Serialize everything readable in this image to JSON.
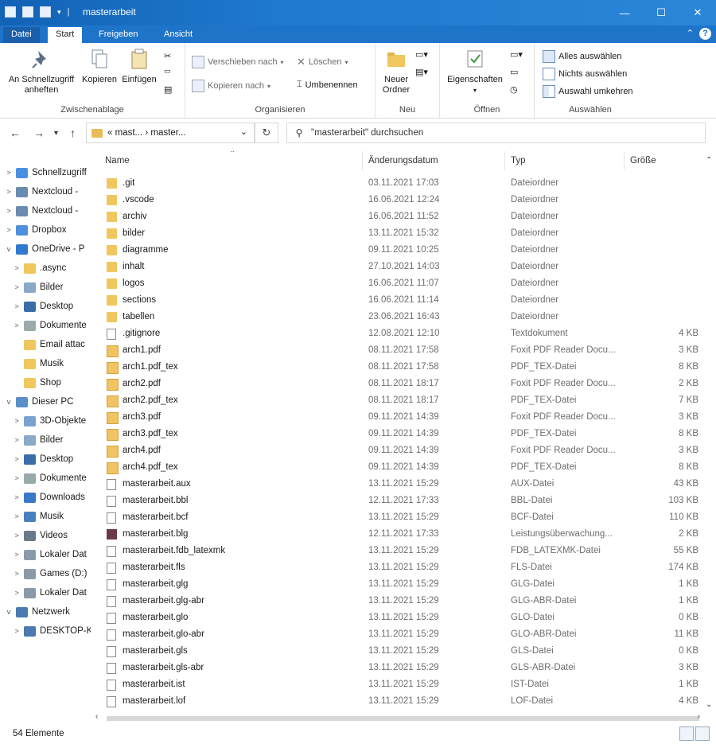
{
  "window": {
    "title": "masterarbeit",
    "controls": {
      "minimize": "—",
      "maximize": "☐",
      "close": "✕"
    }
  },
  "ribbon_tabs": [
    "Datei",
    "Start",
    "Freigeben",
    "Ansicht"
  ],
  "ribbon": {
    "zwischenablage": {
      "label": "Zwischenablage",
      "pin": "An Schnellzugriff anheften",
      "copy": "Kopieren",
      "paste": "Einfügen"
    },
    "organisieren": {
      "label": "Organisieren",
      "move": "Verschieben nach",
      "copy_to": "Kopieren nach",
      "delete": "Löschen",
      "rename": "Umbenennen"
    },
    "neu": {
      "label": "Neu",
      "new_folder": "Neuer Ordner"
    },
    "oeffnen": {
      "label": "Öffnen",
      "properties": "Eigenschaften"
    },
    "auswaehlen": {
      "label": "Auswählen",
      "select_all": "Alles auswählen",
      "select_none": "Nichts auswählen",
      "invert": "Auswahl umkehren"
    }
  },
  "address": {
    "crumbs": [
      "«",
      "mast...",
      "›",
      "master..."
    ],
    "search_placeholder": "\"masterarbeit\" durchsuchen"
  },
  "nav": [
    {
      "label": "Schnellzugriff",
      "indent": 0,
      "arrow": ">",
      "icon": "star-icon"
    },
    {
      "label": "Nextcloud -",
      "indent": 0,
      "arrow": ">",
      "icon": "cloud-icon"
    },
    {
      "label": "Nextcloud -",
      "indent": 0,
      "arrow": ">",
      "icon": "cloud-icon"
    },
    {
      "label": "Dropbox",
      "indent": 0,
      "arrow": ">",
      "icon": "dropbox-icon"
    },
    {
      "label": "OneDrive - P",
      "indent": 0,
      "arrow": "v",
      "icon": "onedrive-icon"
    },
    {
      "label": ".async",
      "indent": 1,
      "arrow": ">",
      "icon": "folder-icon"
    },
    {
      "label": "Bilder",
      "indent": 1,
      "arrow": ">",
      "icon": "pictures-icon"
    },
    {
      "label": "Desktop",
      "indent": 1,
      "arrow": ">",
      "icon": "desktop-icon"
    },
    {
      "label": "Dokumente",
      "indent": 1,
      "arrow": ">",
      "icon": "documents-icon"
    },
    {
      "label": "Email attac",
      "indent": 1,
      "arrow": "",
      "icon": "folder-icon"
    },
    {
      "label": "Musik",
      "indent": 1,
      "arrow": "",
      "icon": "folder-icon"
    },
    {
      "label": "Shop",
      "indent": 1,
      "arrow": "",
      "icon": "folder-icon"
    },
    {
      "label": "Dieser PC",
      "indent": 0,
      "arrow": "v",
      "icon": "pc-icon"
    },
    {
      "label": "3D-Objekte",
      "indent": 1,
      "arrow": ">",
      "icon": "3d-icon"
    },
    {
      "label": "Bilder",
      "indent": 1,
      "arrow": ">",
      "icon": "pictures-icon"
    },
    {
      "label": "Desktop",
      "indent": 1,
      "arrow": ">",
      "icon": "desktop-icon"
    },
    {
      "label": "Dokumente",
      "indent": 1,
      "arrow": ">",
      "icon": "documents-icon"
    },
    {
      "label": "Downloads",
      "indent": 1,
      "arrow": ">",
      "icon": "downloads-icon"
    },
    {
      "label": "Musik",
      "indent": 1,
      "arrow": ">",
      "icon": "music-icon"
    },
    {
      "label": "Videos",
      "indent": 1,
      "arrow": ">",
      "icon": "videos-icon"
    },
    {
      "label": "Lokaler Dat",
      "indent": 1,
      "arrow": ">",
      "icon": "drive-icon"
    },
    {
      "label": "Games (D:)",
      "indent": 1,
      "arrow": ">",
      "icon": "drive-icon"
    },
    {
      "label": "Lokaler Dat",
      "indent": 1,
      "arrow": ">",
      "icon": "drive-icon"
    },
    {
      "label": "Netzwerk",
      "indent": 0,
      "arrow": "v",
      "icon": "network-icon"
    },
    {
      "label": "DESKTOP-K",
      "indent": 1,
      "arrow": ">",
      "icon": "computer-icon"
    }
  ],
  "columns": {
    "name": "Name",
    "date": "Änderungsdatum",
    "type": "Typ",
    "size": "Größe"
  },
  "files": [
    {
      "name": ".git",
      "date": "03.11.2021 17:03",
      "type": "Dateiordner",
      "size": "",
      "kind": "folder"
    },
    {
      "name": ".vscode",
      "date": "16.06.2021 12:24",
      "type": "Dateiordner",
      "size": "",
      "kind": "folder"
    },
    {
      "name": "archiv",
      "date": "16.06.2021 11:52",
      "type": "Dateiordner",
      "size": "",
      "kind": "folder"
    },
    {
      "name": "bilder",
      "date": "13.11.2021 15:32",
      "type": "Dateiordner",
      "size": "",
      "kind": "folder"
    },
    {
      "name": "diagramme",
      "date": "09.11.2021 10:25",
      "type": "Dateiordner",
      "size": "",
      "kind": "folder"
    },
    {
      "name": "inhalt",
      "date": "27.10.2021 14:03",
      "type": "Dateiordner",
      "size": "",
      "kind": "folder"
    },
    {
      "name": "logos",
      "date": "16.06.2021 11:07",
      "type": "Dateiordner",
      "size": "",
      "kind": "folder"
    },
    {
      "name": "sections",
      "date": "16.06.2021 11:14",
      "type": "Dateiordner",
      "size": "",
      "kind": "folder"
    },
    {
      "name": "tabellen",
      "date": "23.06.2021 16:43",
      "type": "Dateiordner",
      "size": "",
      "kind": "folder"
    },
    {
      "name": ".gitignore",
      "date": "12.08.2021 12:10",
      "type": "Textdokument",
      "size": "4 KB",
      "kind": "file"
    },
    {
      "name": "arch1.pdf",
      "date": "08.11.2021 17:58",
      "type": "Foxit PDF Reader Docu...",
      "size": "3 KB",
      "kind": "pdf"
    },
    {
      "name": "arch1.pdf_tex",
      "date": "08.11.2021 17:58",
      "type": "PDF_TEX-Datei",
      "size": "8 KB",
      "kind": "pdf"
    },
    {
      "name": "arch2.pdf",
      "date": "08.11.2021 18:17",
      "type": "Foxit PDF Reader Docu...",
      "size": "2 KB",
      "kind": "pdf"
    },
    {
      "name": "arch2.pdf_tex",
      "date": "08.11.2021 18:17",
      "type": "PDF_TEX-Datei",
      "size": "7 KB",
      "kind": "pdf"
    },
    {
      "name": "arch3.pdf",
      "date": "09.11.2021 14:39",
      "type": "Foxit PDF Reader Docu...",
      "size": "3 KB",
      "kind": "pdf"
    },
    {
      "name": "arch3.pdf_tex",
      "date": "09.11.2021 14:39",
      "type": "PDF_TEX-Datei",
      "size": "8 KB",
      "kind": "pdf"
    },
    {
      "name": "arch4.pdf",
      "date": "09.11.2021 14:39",
      "type": "Foxit PDF Reader Docu...",
      "size": "3 KB",
      "kind": "pdf"
    },
    {
      "name": "arch4.pdf_tex",
      "date": "09.11.2021 14:39",
      "type": "PDF_TEX-Datei",
      "size": "8 KB",
      "kind": "pdf"
    },
    {
      "name": "masterarbeit.aux",
      "date": "13.11.2021 15:29",
      "type": "AUX-Datei",
      "size": "43 KB",
      "kind": "file"
    },
    {
      "name": "masterarbeit.bbl",
      "date": "12.11.2021 17:33",
      "type": "BBL-Datei",
      "size": "103 KB",
      "kind": "file"
    },
    {
      "name": "masterarbeit.bcf",
      "date": "13.11.2021 15:29",
      "type": "BCF-Datei",
      "size": "110 KB",
      "kind": "file"
    },
    {
      "name": "masterarbeit.blg",
      "date": "12.11.2021 17:33",
      "type": "Leistungsüberwachung...",
      "size": "2 KB",
      "kind": "blg"
    },
    {
      "name": "masterarbeit.fdb_latexmk",
      "date": "13.11.2021 15:29",
      "type": "FDB_LATEXMK-Datei",
      "size": "55 KB",
      "kind": "file"
    },
    {
      "name": "masterarbeit.fls",
      "date": "13.11.2021 15:29",
      "type": "FLS-Datei",
      "size": "174 KB",
      "kind": "file"
    },
    {
      "name": "masterarbeit.glg",
      "date": "13.11.2021 15:29",
      "type": "GLG-Datei",
      "size": "1 KB",
      "kind": "file"
    },
    {
      "name": "masterarbeit.glg-abr",
      "date": "13.11.2021 15:29",
      "type": "GLG-ABR-Datei",
      "size": "1 KB",
      "kind": "file"
    },
    {
      "name": "masterarbeit.glo",
      "date": "13.11.2021 15:29",
      "type": "GLO-Datei",
      "size": "0 KB",
      "kind": "file"
    },
    {
      "name": "masterarbeit.glo-abr",
      "date": "13.11.2021 15:29",
      "type": "GLO-ABR-Datei",
      "size": "11 KB",
      "kind": "file"
    },
    {
      "name": "masterarbeit.gls",
      "date": "13.11.2021 15:29",
      "type": "GLS-Datei",
      "size": "0 KB",
      "kind": "file"
    },
    {
      "name": "masterarbeit.gls-abr",
      "date": "13.11.2021 15:29",
      "type": "GLS-ABR-Datei",
      "size": "3 KB",
      "kind": "file"
    },
    {
      "name": "masterarbeit.ist",
      "date": "13.11.2021 15:29",
      "type": "IST-Datei",
      "size": "1 KB",
      "kind": "file"
    },
    {
      "name": "masterarbeit.lof",
      "date": "13.11.2021 15:29",
      "type": "LOF-Datei",
      "size": "4 KB",
      "kind": "file"
    }
  ],
  "status": {
    "count": "54 Elemente"
  },
  "colors": {
    "titlebar": "#1a6fc4",
    "folder": "#efc75e",
    "accent": "#1e74c9"
  }
}
